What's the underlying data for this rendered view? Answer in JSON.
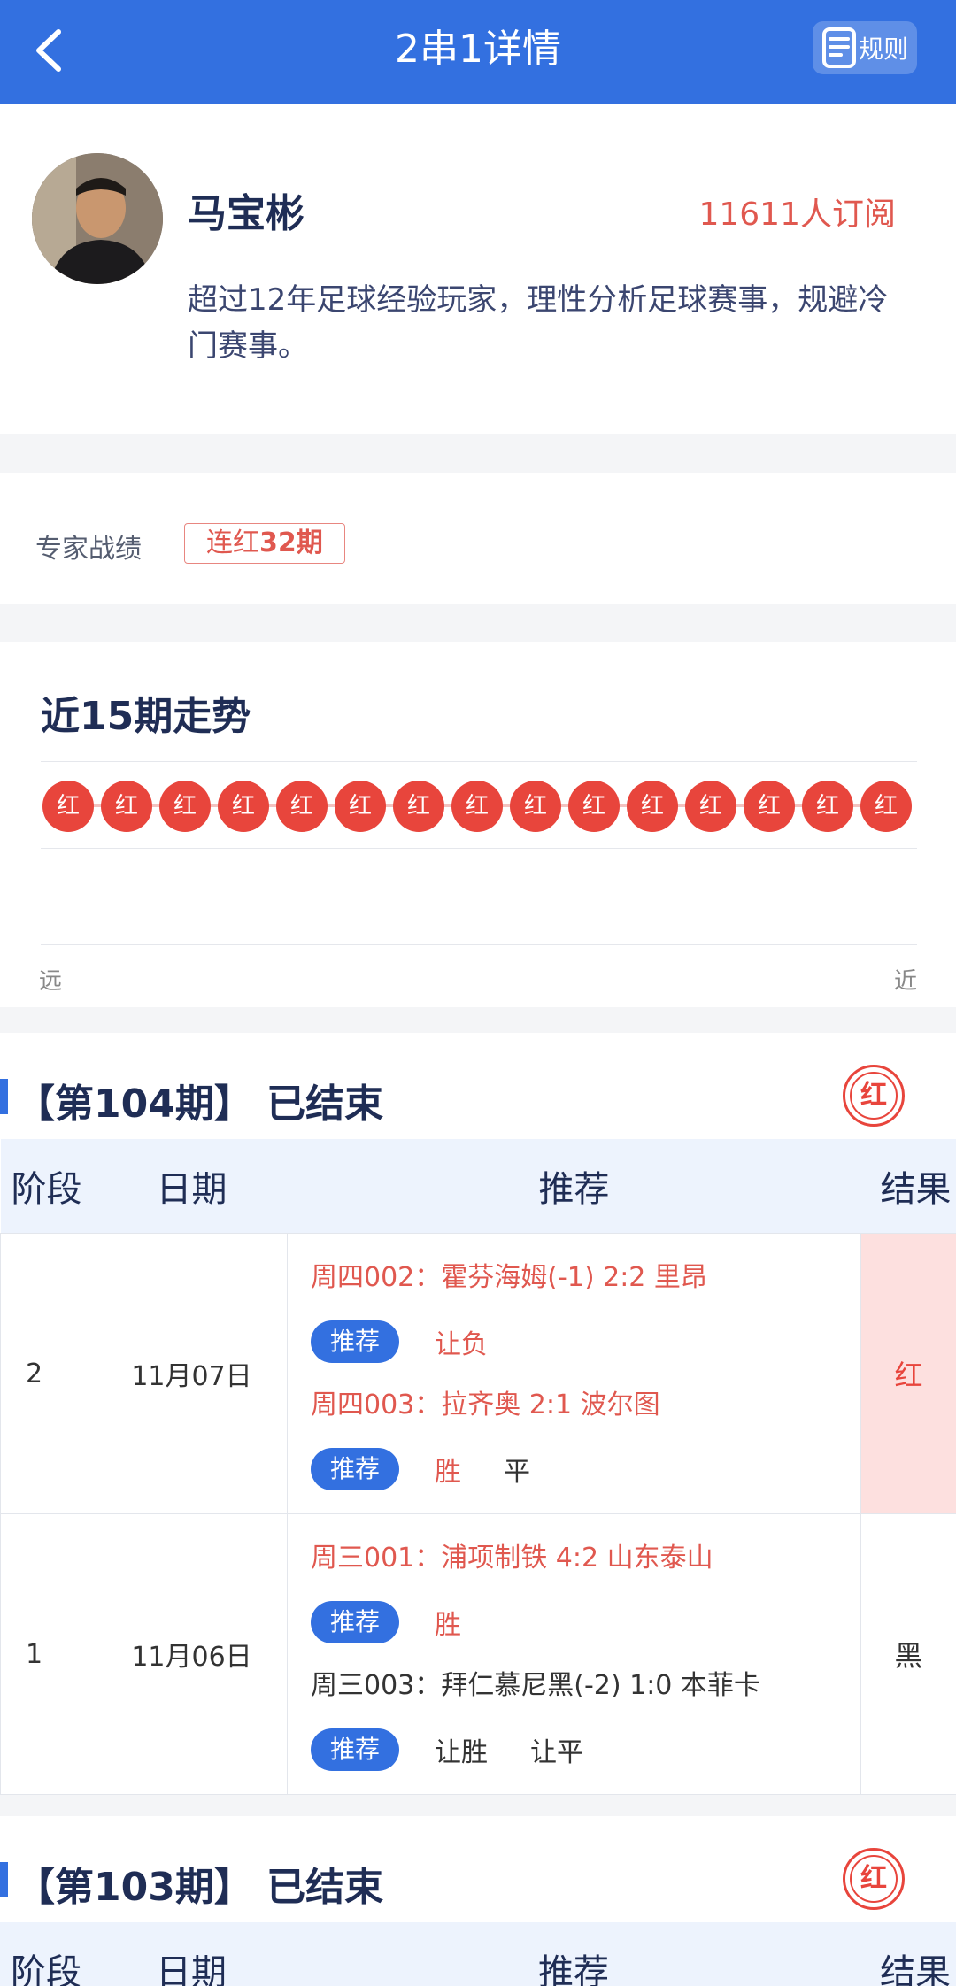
{
  "header": {
    "title": "2串1详情",
    "rules_label": "规则"
  },
  "expert": {
    "name": "马宝彬",
    "subscribers": "11611人订阅",
    "bio": "超过12年足球经验玩家，理性分析足球赛事，规避冷门赛事。"
  },
  "record": {
    "label": "专家战绩",
    "streak_prefix": "连红",
    "streak_value": "32期"
  },
  "trend": {
    "title": "近15期走势",
    "results": [
      "红",
      "红",
      "红",
      "红",
      "红",
      "红",
      "红",
      "红",
      "红",
      "红",
      "红",
      "红",
      "红",
      "红",
      "红"
    ],
    "far_label": "远",
    "near_label": "近"
  },
  "table_headers": {
    "stage": "阶段",
    "date": "日期",
    "recommend": "推荐",
    "result": "结果"
  },
  "pick_button_label": "推荐",
  "periods": [
    {
      "title": "【第104期】 已结束",
      "stamp": "红",
      "rows": [
        {
          "stage": "2",
          "date": "11月07日",
          "result": "红",
          "matches": [
            {
              "text": "周四002：霍芬海姆(-1) 2:2 里昂",
              "picks": [
                "让负"
              ]
            },
            {
              "text": "周四003：拉齐奥 2:1 波尔图",
              "picks": [
                "胜",
                "平"
              ]
            }
          ]
        },
        {
          "stage": "1",
          "date": "11月06日",
          "result": "黑",
          "matches": [
            {
              "text": "周三001：浦项制铁 4:2 山东泰山",
              "picks": [
                "胜"
              ]
            },
            {
              "text": "周三003：拜仁慕尼黑(-2) 1:0 本菲卡",
              "picks": [
                "让胜",
                "让平"
              ]
            }
          ]
        }
      ]
    },
    {
      "title": "【第103期】 已结束",
      "stamp": "红"
    }
  ],
  "colors": {
    "brand_blue": "#3370e0",
    "red": "#e8453c",
    "text_dark": "#1f2d55"
  }
}
